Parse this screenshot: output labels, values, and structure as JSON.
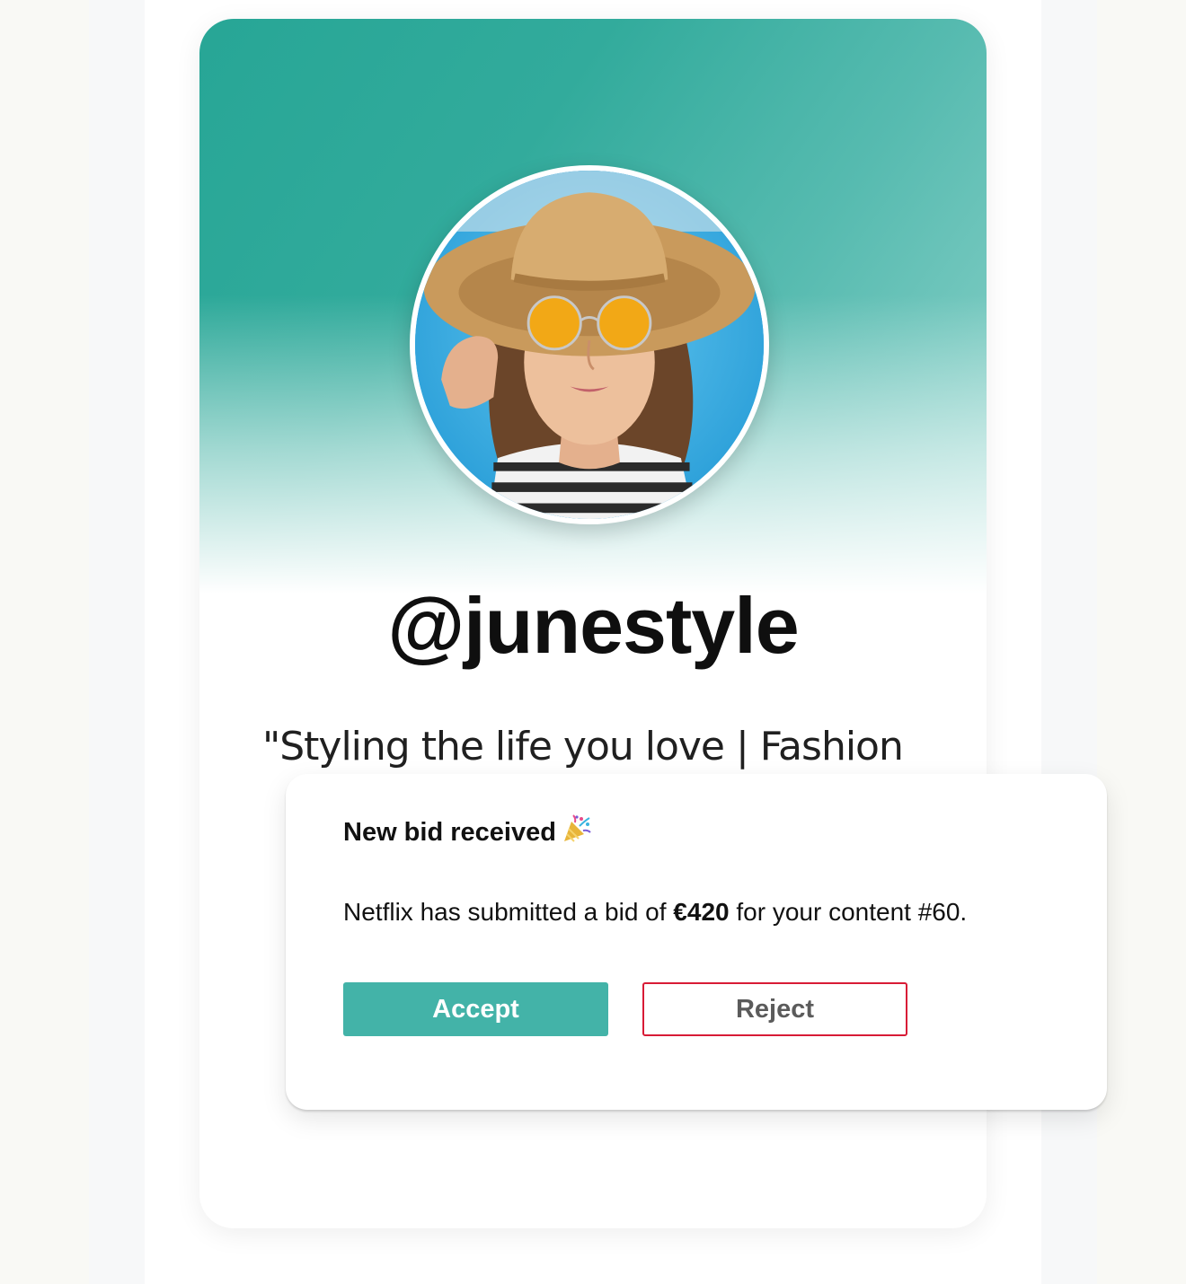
{
  "profile": {
    "username": "@junestyle",
    "bio": "\"Styling the life you love | Fashion"
  },
  "notification": {
    "title": "New bid received",
    "title_icon": "party-popper-icon",
    "message_prefix": "Netflix has submitted a bid of ",
    "amount": "€420",
    "message_suffix": " for your content #60.",
    "accept_label": "Accept",
    "reject_label": "Reject"
  },
  "colors": {
    "accent": "#43b3a8",
    "header_teal": "#27a696",
    "reject_border": "#d81b36"
  }
}
